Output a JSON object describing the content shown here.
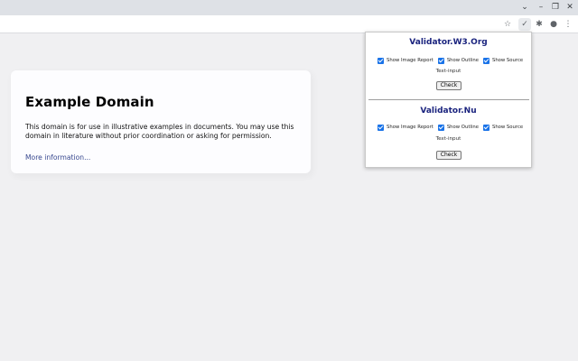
{
  "browser": {
    "window_controls": {
      "menu": "⌄",
      "minimize": "–",
      "restore": "❐",
      "close": "✕"
    },
    "toolbar_icons": {
      "bookmark": "☆",
      "validator_ext": "✓",
      "extensions": "✱",
      "profile": "●",
      "menu": "⋮"
    }
  },
  "page": {
    "heading": "Example Domain",
    "paragraph": "This domain is for use in illustrative examples in documents. You may use this domain in literature without prior coordination or asking for permission.",
    "link": "More information..."
  },
  "popup": {
    "sections": [
      {
        "title": "Validator.W3.Org",
        "options": [
          "Show Image Report",
          "Show Outline",
          "Show Source"
        ],
        "text_input": "Text-input",
        "button": "Check"
      },
      {
        "title": "Validator.Nu",
        "options": [
          "Show Image Report",
          "Show Outline",
          "Show Source"
        ],
        "text_input": "Text-input",
        "button": "Check"
      }
    ]
  },
  "colors": {
    "accent": "#1a73e8",
    "title": "#1a237e",
    "link": "#38488f",
    "page_bg": "#f0f0f2"
  }
}
